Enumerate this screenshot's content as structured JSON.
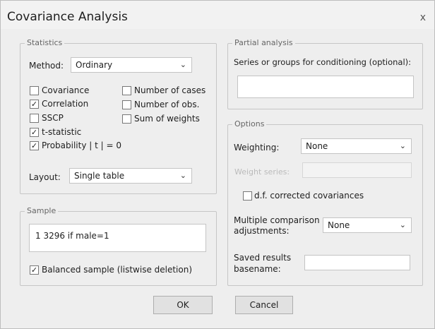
{
  "window": {
    "title": "Covariance Analysis",
    "close_glyph": "x"
  },
  "statistics": {
    "group_label": "Statistics",
    "method_label": "Method:",
    "method_value": "Ordinary",
    "checkboxes": [
      {
        "label": "Covariance",
        "checked": false
      },
      {
        "label": "Correlation",
        "checked": true
      },
      {
        "label": "SSCP",
        "checked": false
      },
      {
        "label": "t-statistic",
        "checked": true
      },
      {
        "label": "Probability | t | = 0",
        "checked": true
      },
      {
        "label": "Number of cases",
        "checked": false
      },
      {
        "label": "Number of obs.",
        "checked": false
      },
      {
        "label": "Sum of weights",
        "checked": false
      }
    ],
    "layout_label": "Layout:",
    "layout_value": "Single table"
  },
  "sample": {
    "group_label": "Sample",
    "value": "1 3296 if male=1",
    "balanced_label": "Balanced sample (listwise deletion)",
    "balanced_checked": true
  },
  "partial": {
    "group_label": "Partial analysis",
    "series_label": "Series or groups for conditioning (optional):",
    "series_value": ""
  },
  "options": {
    "group_label": "Options",
    "weighting_label": "Weighting:",
    "weighting_value": "None",
    "weight_series_label": "Weight series:",
    "weight_series_value": "",
    "df_label": "d.f. corrected covariances",
    "df_checked": false,
    "multiple_label_1": "Multiple comparison",
    "multiple_label_2": "adjustments:",
    "multiple_value": "None",
    "saved_label_1": "Saved results",
    "saved_label_2": "basename:",
    "saved_value": ""
  },
  "buttons": {
    "ok": "OK",
    "cancel": "Cancel"
  },
  "glyphs": {
    "check": "✓",
    "chevron": "⌄"
  }
}
